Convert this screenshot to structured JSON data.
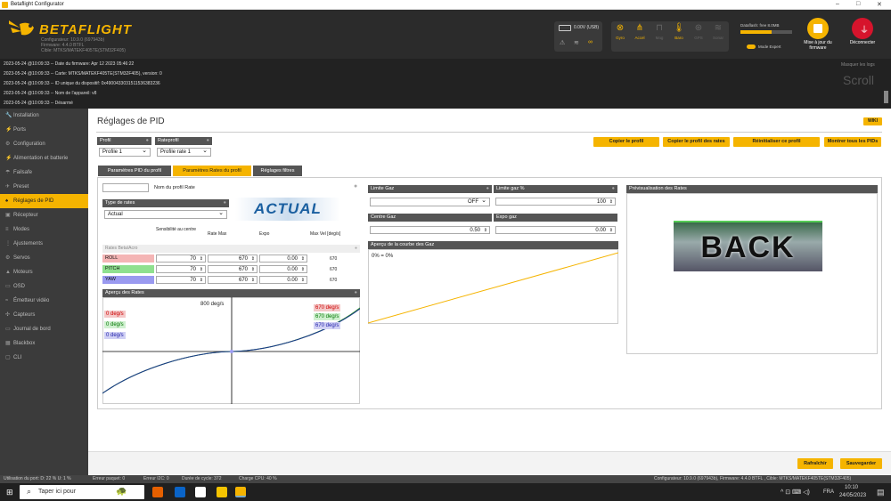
{
  "window": {
    "title": "Betaflight Configurator",
    "controls": [
      "–",
      "□",
      "✕"
    ]
  },
  "header": {
    "logo": "BETAFLIGHT",
    "sub": [
      "Configurateur: 10.9.0 (697943b)",
      "Firmware: 4.4.0 BTFL",
      "Cible: MTKS/MATEKF405TE(STM32F405)"
    ],
    "battery": "0.00V (USB)",
    "sensors": [
      "Gyro",
      "Accel",
      "Mag",
      "Baro",
      "GPS",
      "Sonar"
    ],
    "dataflash": "Dataflash: free 8.0MB",
    "expert": "Mode Expert",
    "firmware_btn": "Mise à jour du firmware",
    "disconnect_btn": "Déconnecter"
  },
  "log": {
    "lines": [
      "2023-05-24 @10:09:33 -- Date du firmware: Apr 12 2023 05:46:22",
      "2023-05-24 @10:09:33 -- Carte: MTKS/MATEKF405TE(STM32F405), version: 0",
      "2023-05-24 @10:09:33 -- ID unique du dispositif: 0x490043303151153638323​6",
      "2023-05-24 @10:09:33 -- Nom de l'appareil: v8",
      "2023-05-24 @10:09:33 -- Désarmé"
    ],
    "hide": "Masquer les logs",
    "scroll": "Scroll"
  },
  "sidebar": [
    {
      "icon": "🔧",
      "label": "Installation"
    },
    {
      "icon": "⚡",
      "label": "Ports"
    },
    {
      "icon": "⚙",
      "label": "Configuration"
    },
    {
      "icon": "⚡",
      "label": "Alimentation et batterie"
    },
    {
      "icon": "☂",
      "label": "Failsafe"
    },
    {
      "icon": "✈",
      "label": "Preset"
    },
    {
      "icon": "♠",
      "label": "Réglages de PID"
    },
    {
      "icon": "▣",
      "label": "Récepteur"
    },
    {
      "icon": "≡",
      "label": "Modes"
    },
    {
      "icon": "⋮",
      "label": "Ajustements"
    },
    {
      "icon": "⚙",
      "label": "Servos"
    },
    {
      "icon": "▲",
      "label": "Moteurs"
    },
    {
      "icon": "▭",
      "label": "OSD"
    },
    {
      "icon": "≈",
      "label": "Émetteur vidéo"
    },
    {
      "icon": "✣",
      "label": "Capteurs"
    },
    {
      "icon": "▭",
      "label": "Journal de bord"
    },
    {
      "icon": "▦",
      "label": "Blackbox"
    },
    {
      "icon": "▢",
      "label": "CLI"
    }
  ],
  "page": {
    "title": "Réglages de PID",
    "wiki": "WIKI",
    "profil_label": "Profil",
    "profil_value": "Profile 1",
    "rateprofil_label": "Rateprofil",
    "rateprofil_value": "Profile rate 1",
    "buttons": [
      "Copier le profil",
      "Copier le profil des rates",
      "Réinitialiser ce profil",
      "Montrer tous les PIDs"
    ],
    "tabs": [
      "Paramètres PID du profil",
      "Paramètres Rates du profil",
      "Réglages filtres"
    ],
    "rate_name_label": "Nom du profil Rate",
    "rates_type_label": "Type de rates",
    "rates_type_value": "Actual",
    "rates_logo": "ACTUAL",
    "cols": [
      "Sensibilité au centre",
      "Rate Max",
      "Expo",
      "Max Vel [deg/s]"
    ],
    "rates_header": "Rates Beta/Acro",
    "axes": [
      {
        "name": "ROLL",
        "color": "#f4b5b5",
        "center": "70",
        "max": "670",
        "expo": "0.00",
        "vel": "670"
      },
      {
        "name": "PITCH",
        "color": "#8fe08f",
        "center": "70",
        "max": "670",
        "expo": "0.00",
        "vel": "670"
      },
      {
        "name": "YAW",
        "color": "#9a9af0",
        "center": "70",
        "max": "670",
        "expo": "0.00",
        "vel": "670"
      }
    ],
    "apercu_rates": "Aperçu des Rates",
    "graph_top": "800 deg/s",
    "graph_left": [
      "0 deg/s",
      "0 deg/s",
      "0 deg/s"
    ],
    "graph_right": [
      "670 deg/s",
      "670 deg/s",
      "670 deg/s"
    ],
    "limite_gaz": "Limite Gaz",
    "limite_gaz_value": "OFF",
    "limite_gaz_pct": "Limite gaz %",
    "limite_gaz_pct_value": "100",
    "centre_gaz": "Centre Gaz",
    "centre_gaz_value": "0.50",
    "expo_gaz": "Expo gaz",
    "expo_gaz_value": "0.00",
    "courbe_gaz": "Aperçu de la courbe des Gaz",
    "courbe_readout": "0% = 0%",
    "preview_rates": "Prévisualisation des Rates",
    "preview_text": "BACK",
    "refresh": "Rafraîchir",
    "save": "Sauvegarder"
  },
  "status": {
    "left": [
      "Utilisation du port: D: 22 % U: 1 %",
      "Erreur paquet: 0",
      "Erreur I2C: 0",
      "Durée de cycle: 372",
      "Charge CPU: 40 %"
    ],
    "right": "Configurateur: 10.9.0 (697943b), Firmware: 4.4.0 BTFL , Cible: MTKS/MATEKF405TE(STM32F405)"
  },
  "taskbar": {
    "search": "Taper ici pour",
    "lang": "FRA",
    "time": "10:10",
    "date": "24/05/2023"
  }
}
